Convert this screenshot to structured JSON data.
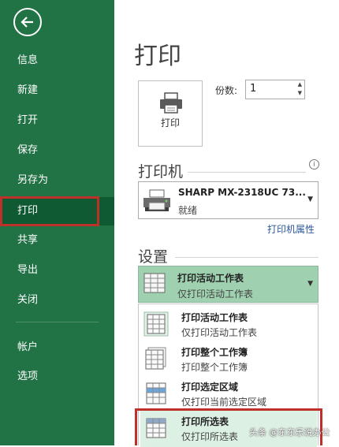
{
  "sidebar": {
    "items": [
      {
        "label": "信息"
      },
      {
        "label": "新建"
      },
      {
        "label": "打开"
      },
      {
        "label": "保存"
      },
      {
        "label": "另存为"
      },
      {
        "label": "打印"
      },
      {
        "label": "共享"
      },
      {
        "label": "导出"
      },
      {
        "label": "关闭"
      },
      {
        "label": "帐户"
      },
      {
        "label": "选项"
      }
    ]
  },
  "main": {
    "title": "打印",
    "print_button_label": "打印",
    "copies_label": "份数:",
    "copies_value": "1",
    "printer_section_title": "打印机",
    "printer": {
      "name": "SHARP MX-2318UC 73...",
      "status": "就绪",
      "properties_link": "打印机属性"
    },
    "settings_section_title": "设置",
    "settings_dropdown": {
      "title": "打印活动工作表",
      "subtitle": "仅打印活动工作表"
    },
    "menu_items": [
      {
        "title": "打印活动工作表",
        "subtitle": "仅打印活动工作表"
      },
      {
        "title": "打印整个工作簿",
        "subtitle": "打印整个工作簿"
      },
      {
        "title": "打印选定区域",
        "subtitle": "仅打印当前选定区域"
      },
      {
        "title": "打印所选表",
        "subtitle": "仅打印所选表"
      }
    ]
  },
  "watermark": "头条 @东东乐说办公",
  "colors": {
    "sidebar": "#217346",
    "highlight_box": "#c0302a",
    "link": "#2b579a"
  }
}
